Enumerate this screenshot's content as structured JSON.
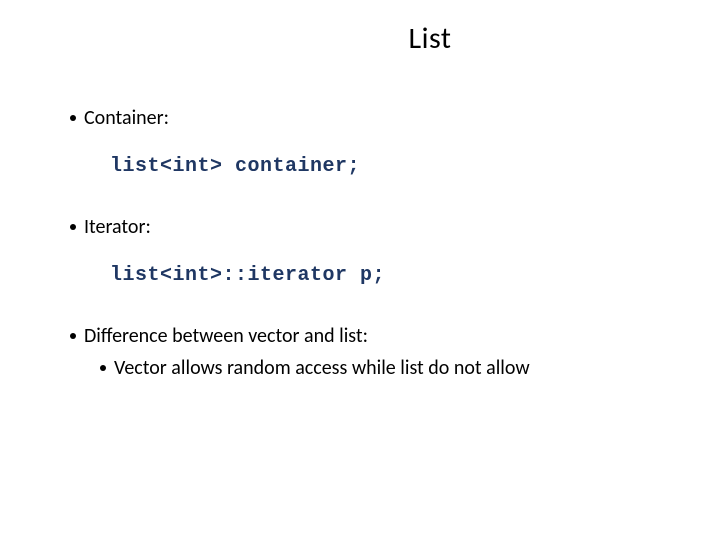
{
  "title": "List",
  "bullets": {
    "container": "Container:",
    "iterator": "Iterator:",
    "diff": "Difference between vector and list:",
    "diff_sub": "Vector allows random access while list do not allow"
  },
  "code": {
    "container_decl": "list<int> container;",
    "iterator_decl": "list<int>::iterator p;"
  }
}
